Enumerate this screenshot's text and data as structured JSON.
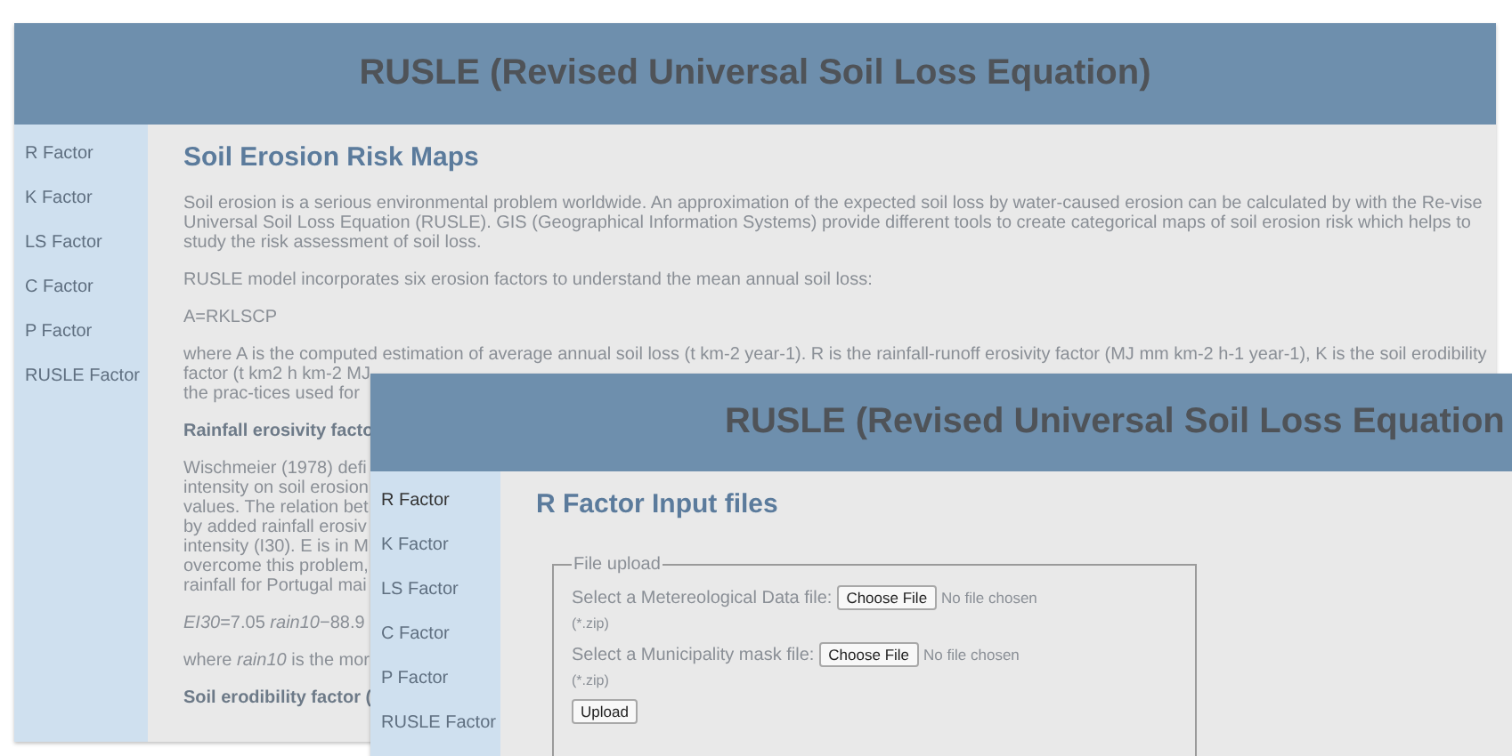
{
  "back_window": {
    "title": "RUSLE (Revised Universal Soil Loss Equation)",
    "sidebar": {
      "items": [
        {
          "label": "R Factor",
          "selected": false
        },
        {
          "label": "K Factor",
          "selected": false
        },
        {
          "label": "LS Factor",
          "selected": false
        },
        {
          "label": "C Factor",
          "selected": false
        },
        {
          "label": "P Factor",
          "selected": false
        },
        {
          "label": "RUSLE Factor",
          "selected": false
        }
      ]
    },
    "blocks": [
      {
        "kind": "heading",
        "lines": [
          "Soil Erosion Risk Maps"
        ]
      },
      {
        "kind": "paragraph",
        "lines": [
          "Soil erosion is a serious environmental problem worldwide. An approximation of the expected soil loss by water-caused erosion can be calculated by with the Re-vise",
          "Universal Soil Loss Equation (RUSLE). GIS (Geographical Information Systems) provide different tools to create categorical maps of soil erosion risk which helps to",
          "study the risk assessment of soil loss."
        ]
      },
      {
        "kind": "paragraph",
        "lines": [
          "RUSLE model incorporates six erosion factors to understand the mean annual soil loss:"
        ]
      },
      {
        "kind": "paragraph",
        "lines": [
          "A=RKLSCP"
        ]
      },
      {
        "kind": "paragraph",
        "lines": [
          "where A is the computed estimation of average annual soil loss (t km-2 year-1). R is the rainfall-runoff erosivity factor (MJ mm km-2 h-1 year-1), K is the soil erodibility",
          "factor (t km2 h km-2 MJ",
          "the prac-tices used for"
        ]
      },
      {
        "kind": "subheading",
        "lines": [
          "Rainfall erosivity facto"
        ]
      },
      {
        "kind": "paragraph",
        "lines": [
          "Wischmeier (1978) defi",
          "intensity on soil erosion",
          "values. The relation bet",
          "by added rainfall erosiv",
          "intensity (I30). E is in M",
          "overcome this problem,",
          "rainfall for Portugal mai"
        ]
      },
      {
        "kind": "paragraph",
        "lines": [
          "*EI30*=7.05 *rain10*−88.9"
        ]
      },
      {
        "kind": "paragraph",
        "lines": [
          "where *rain10* is the mor"
        ]
      },
      {
        "kind": "subheading",
        "lines": [
          "Soil erodibility factor ("
        ]
      }
    ]
  },
  "front_window": {
    "title": "RUSLE (Revised Universal Soil Loss Equation",
    "sidebar": {
      "items": [
        {
          "label": "R Factor",
          "selected": true
        },
        {
          "label": "K Factor",
          "selected": false
        },
        {
          "label": "LS Factor",
          "selected": false
        },
        {
          "label": "C Factor",
          "selected": false
        },
        {
          "label": "P Factor",
          "selected": false
        },
        {
          "label": "RUSLE Factor",
          "selected": false
        }
      ]
    },
    "heading": "R Factor Input files",
    "fieldset": {
      "legend": "File upload",
      "fields": [
        {
          "label": "Select a Metereological Data file:",
          "button": "Choose File",
          "status": "No file chosen",
          "hint": "(*.zip)"
        },
        {
          "label": "Select a Municipality mask file:",
          "button": "Choose File",
          "status": "No file chosen",
          "hint": "(*.zip)"
        }
      ],
      "submit": "Upload"
    }
  }
}
